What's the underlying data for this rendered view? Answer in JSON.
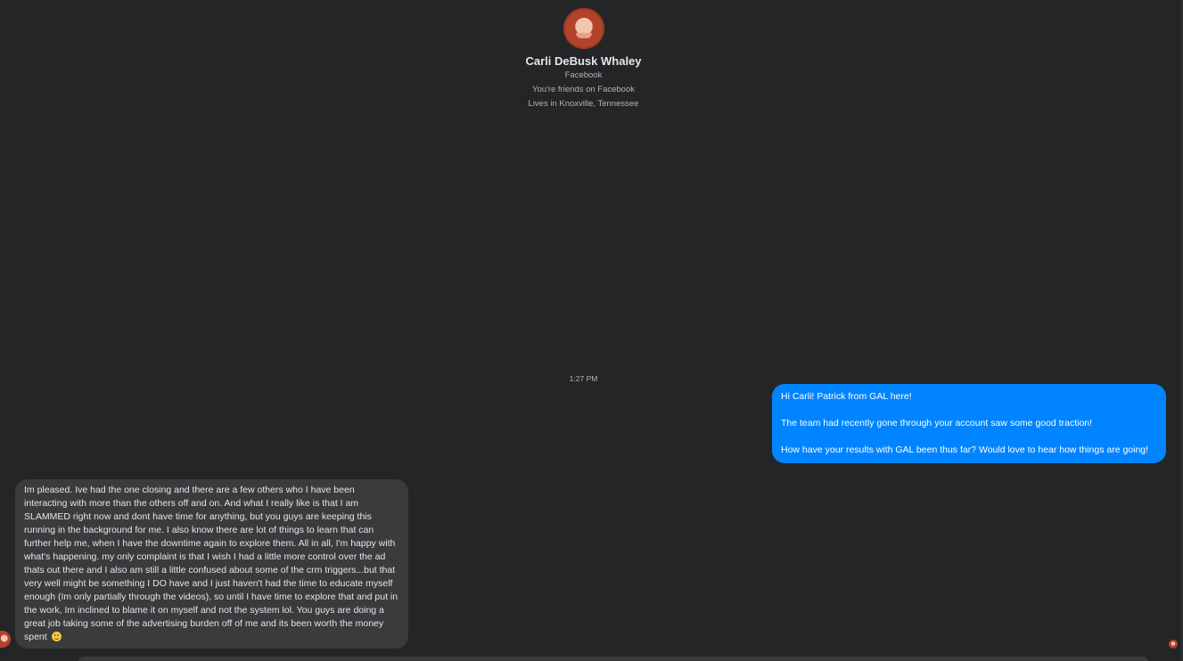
{
  "contact": {
    "name": "Carli DeBusk Whaley",
    "platform": "Facebook",
    "friendship": "You're friends on Facebook",
    "location": "Lives in Knoxville, Tennessee"
  },
  "conversation": {
    "timestamp": "1:27 PM",
    "outgoing": {
      "paragraphs": [
        "Hi Carli! Patrick from GAL here!",
        "The team had recently gone through your account saw some good traction!",
        "How have your results with GAL been thus far? Would love to hear how things are going!"
      ]
    },
    "incoming": {
      "text": "Im pleased. Ive had the one closing and there are a few others who I have been interacting with more than the others off and on.  And what I really like is that I am SLAMMED right now and dont have time for anything, but you guys are keeping this running in the background for me. I also know there are  lot of things to learn that can further help me, when I have the downtime again to explore them. All in all, I'm happy with what's happening. my only complaint is that I wish I had a little more control over the ad thats out there and I also am still a little confused about some of the crm triggers...but that very well might be something I DO have and I just haven't had the time to educate myself enough (Im only partially through the videos), so until I have time to explore that and put in the work, Im inclined to blame it on myself and not the system lol. You guys are doing a great job taking some of the advertising burden off of me and its been worth the money spent",
      "emoji": "slightly-smiling-face-icon"
    }
  },
  "colors": {
    "background": "#242526",
    "outgoing_bubble": "#0084ff",
    "incoming_bubble": "#3a3b3c",
    "primary_text": "#e4e6eb",
    "secondary_text": "#b0b3b8"
  }
}
